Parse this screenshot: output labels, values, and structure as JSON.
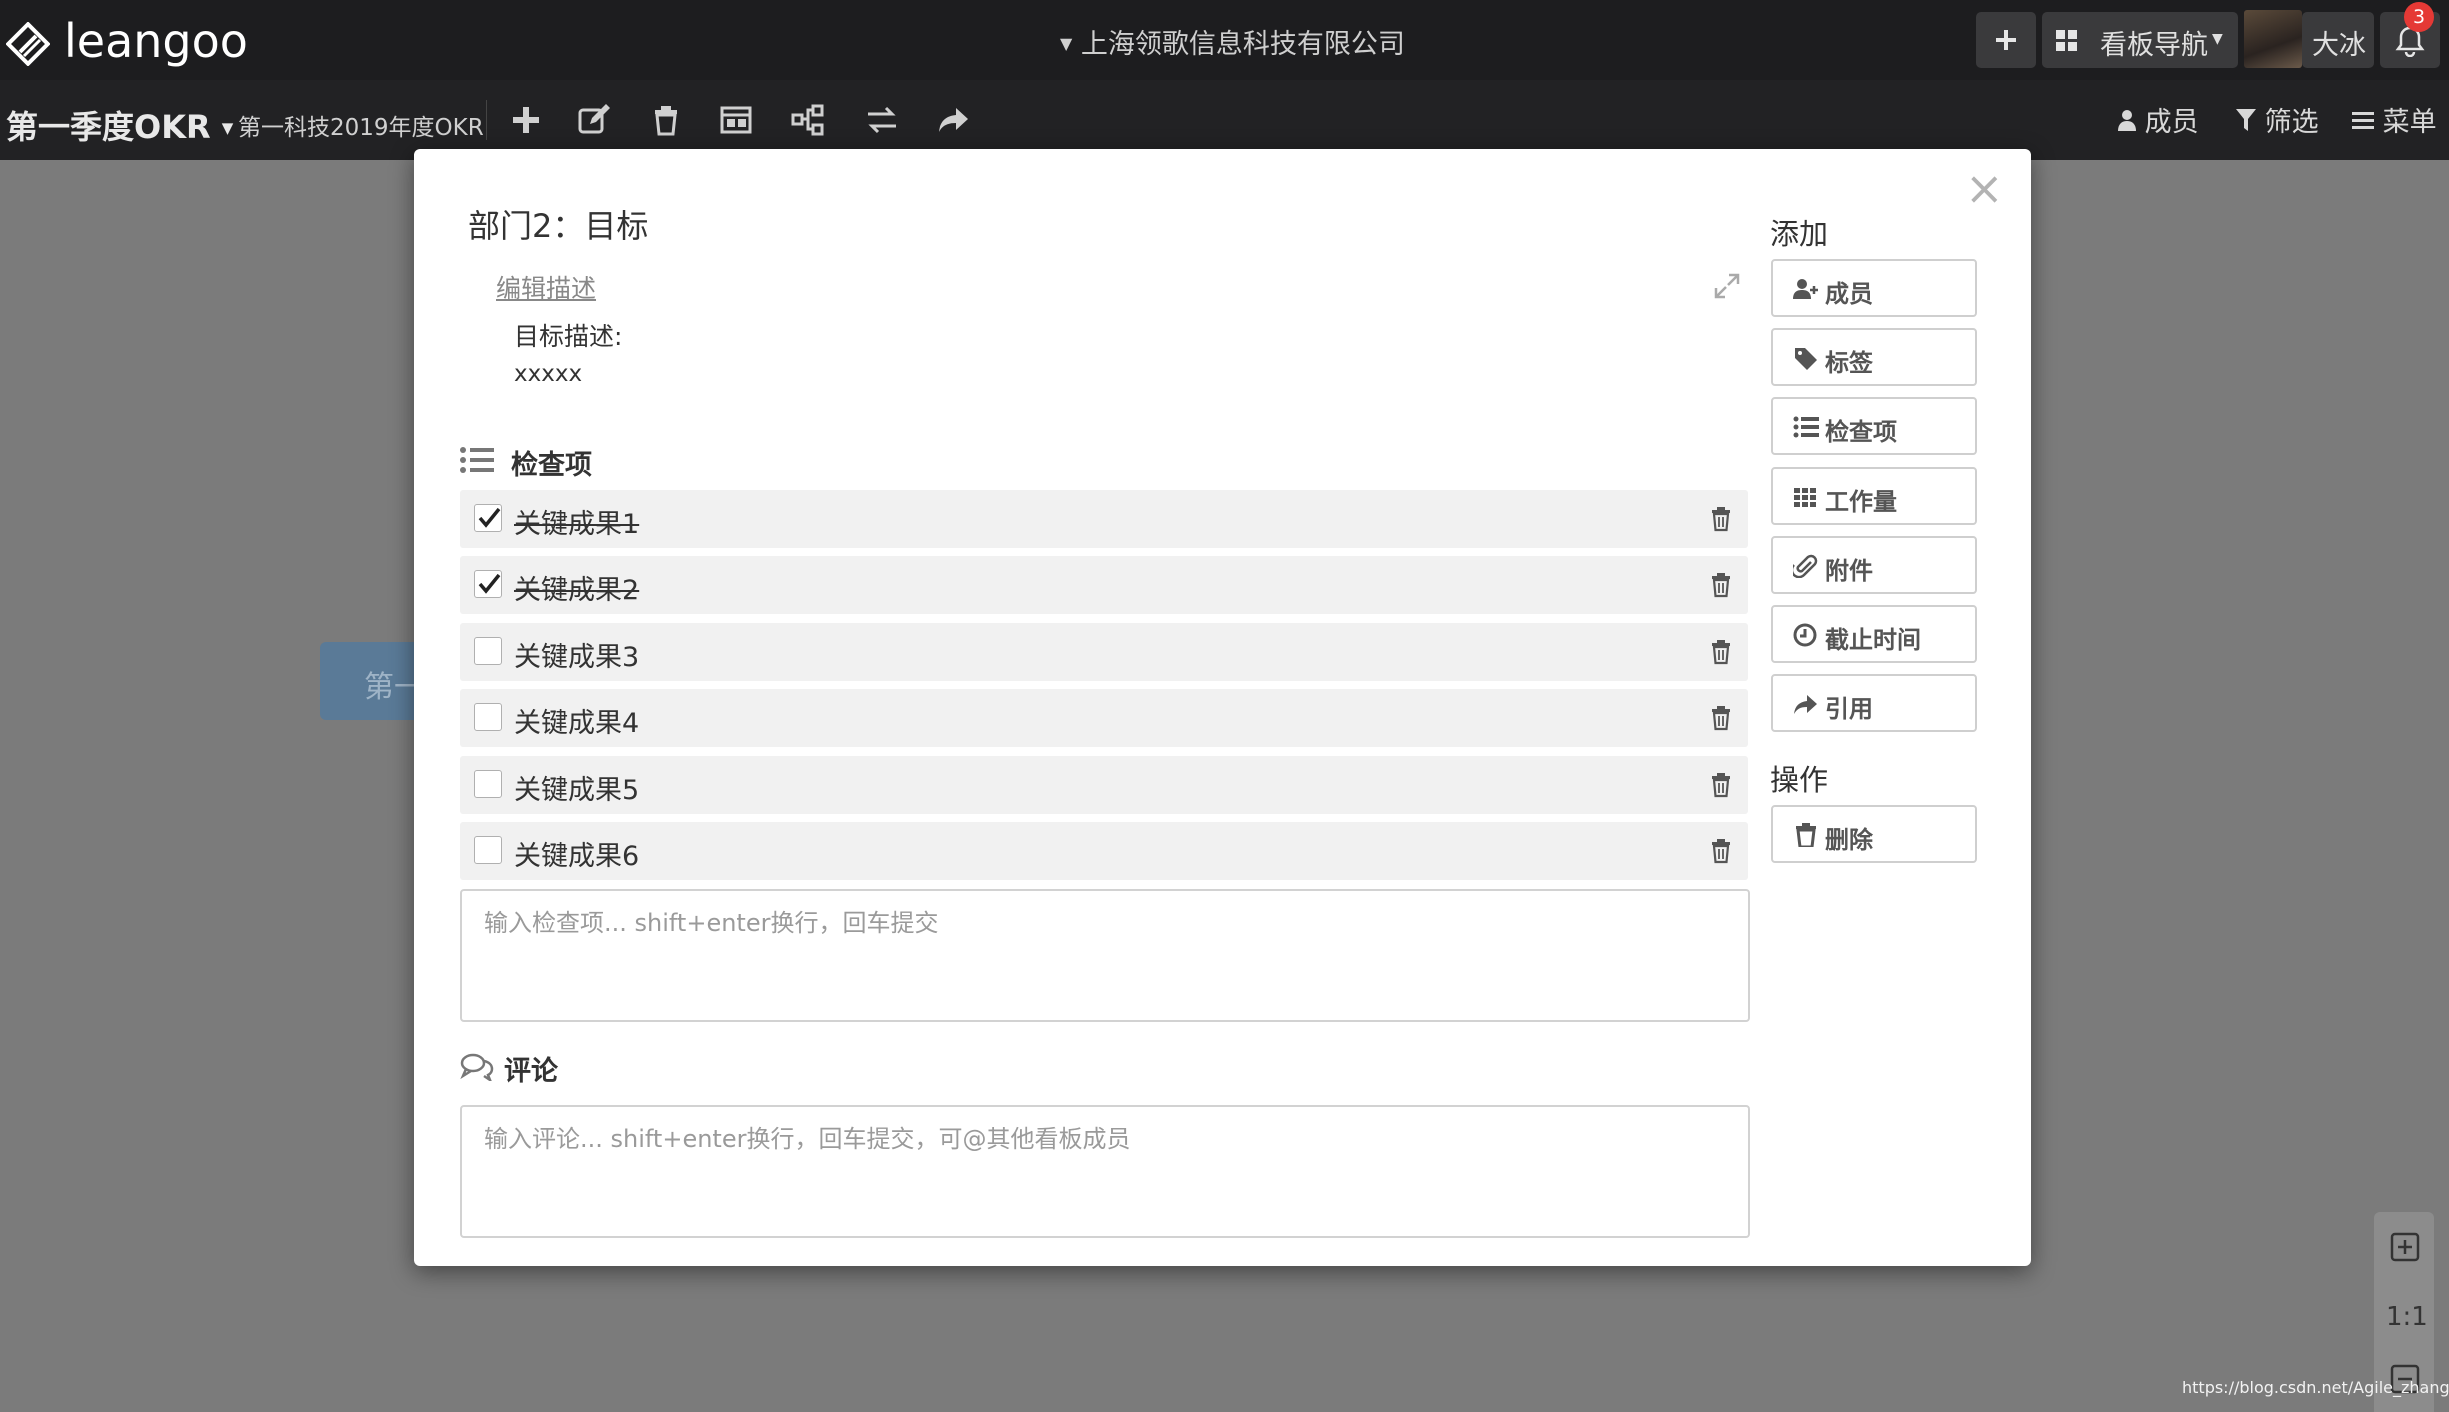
{
  "app": {
    "logo_text": "leangoo",
    "company": "上海领歌信息科技有限公司",
    "board_nav_label": "看板导航",
    "user_name": "大冰",
    "notification_count": "3"
  },
  "board": {
    "title": "第一季度OKR",
    "subtitle": "第一科技2019年度OKR",
    "members_label": "成员",
    "filter_label": "筛选",
    "menu_label": "菜单"
  },
  "canvas": {
    "card_text": "第一",
    "zoom_ratio": "1:1",
    "watermark": "https://blog.csdn.net/Agile_zhanglao"
  },
  "modal": {
    "close_glyph": "×",
    "title": "部门2：目标",
    "edit_description_link": "编辑描述",
    "description_label": "目标描述:",
    "description_value": "xxxxx",
    "checklist_heading": "检查项",
    "checklist": [
      {
        "label": "关键成果1",
        "checked": true
      },
      {
        "label": "关键成果2",
        "checked": true
      },
      {
        "label": "关键成果3",
        "checked": false
      },
      {
        "label": "关键成果4",
        "checked": false
      },
      {
        "label": "关键成果5",
        "checked": false
      },
      {
        "label": "关键成果6",
        "checked": false
      }
    ],
    "checklist_input_placeholder": "输入检查项... shift+enter换行，回车提交",
    "comment_heading": "评论",
    "comment_input_placeholder": "输入评论... shift+enter换行，回车提交，可@其他看板成员",
    "side": {
      "add_heading": "添加",
      "add_buttons": [
        {
          "label": "成员",
          "icon": "add-user-icon"
        },
        {
          "label": "标签",
          "icon": "tag-icon"
        },
        {
          "label": "检查项",
          "icon": "list-icon"
        },
        {
          "label": "工作量",
          "icon": "grid-icon"
        },
        {
          "label": "附件",
          "icon": "paperclip-icon"
        },
        {
          "label": "截止时间",
          "icon": "clock-icon"
        },
        {
          "label": "引用",
          "icon": "share-icon"
        }
      ],
      "ops_heading": "操作",
      "delete_button": {
        "label": "删除",
        "icon": "trash-icon"
      }
    }
  },
  "colors": {
    "topbar": "#1d1d1f",
    "toolbar": "#222224",
    "overlay": "#7b7b7b",
    "notification_badge": "#e53935"
  }
}
